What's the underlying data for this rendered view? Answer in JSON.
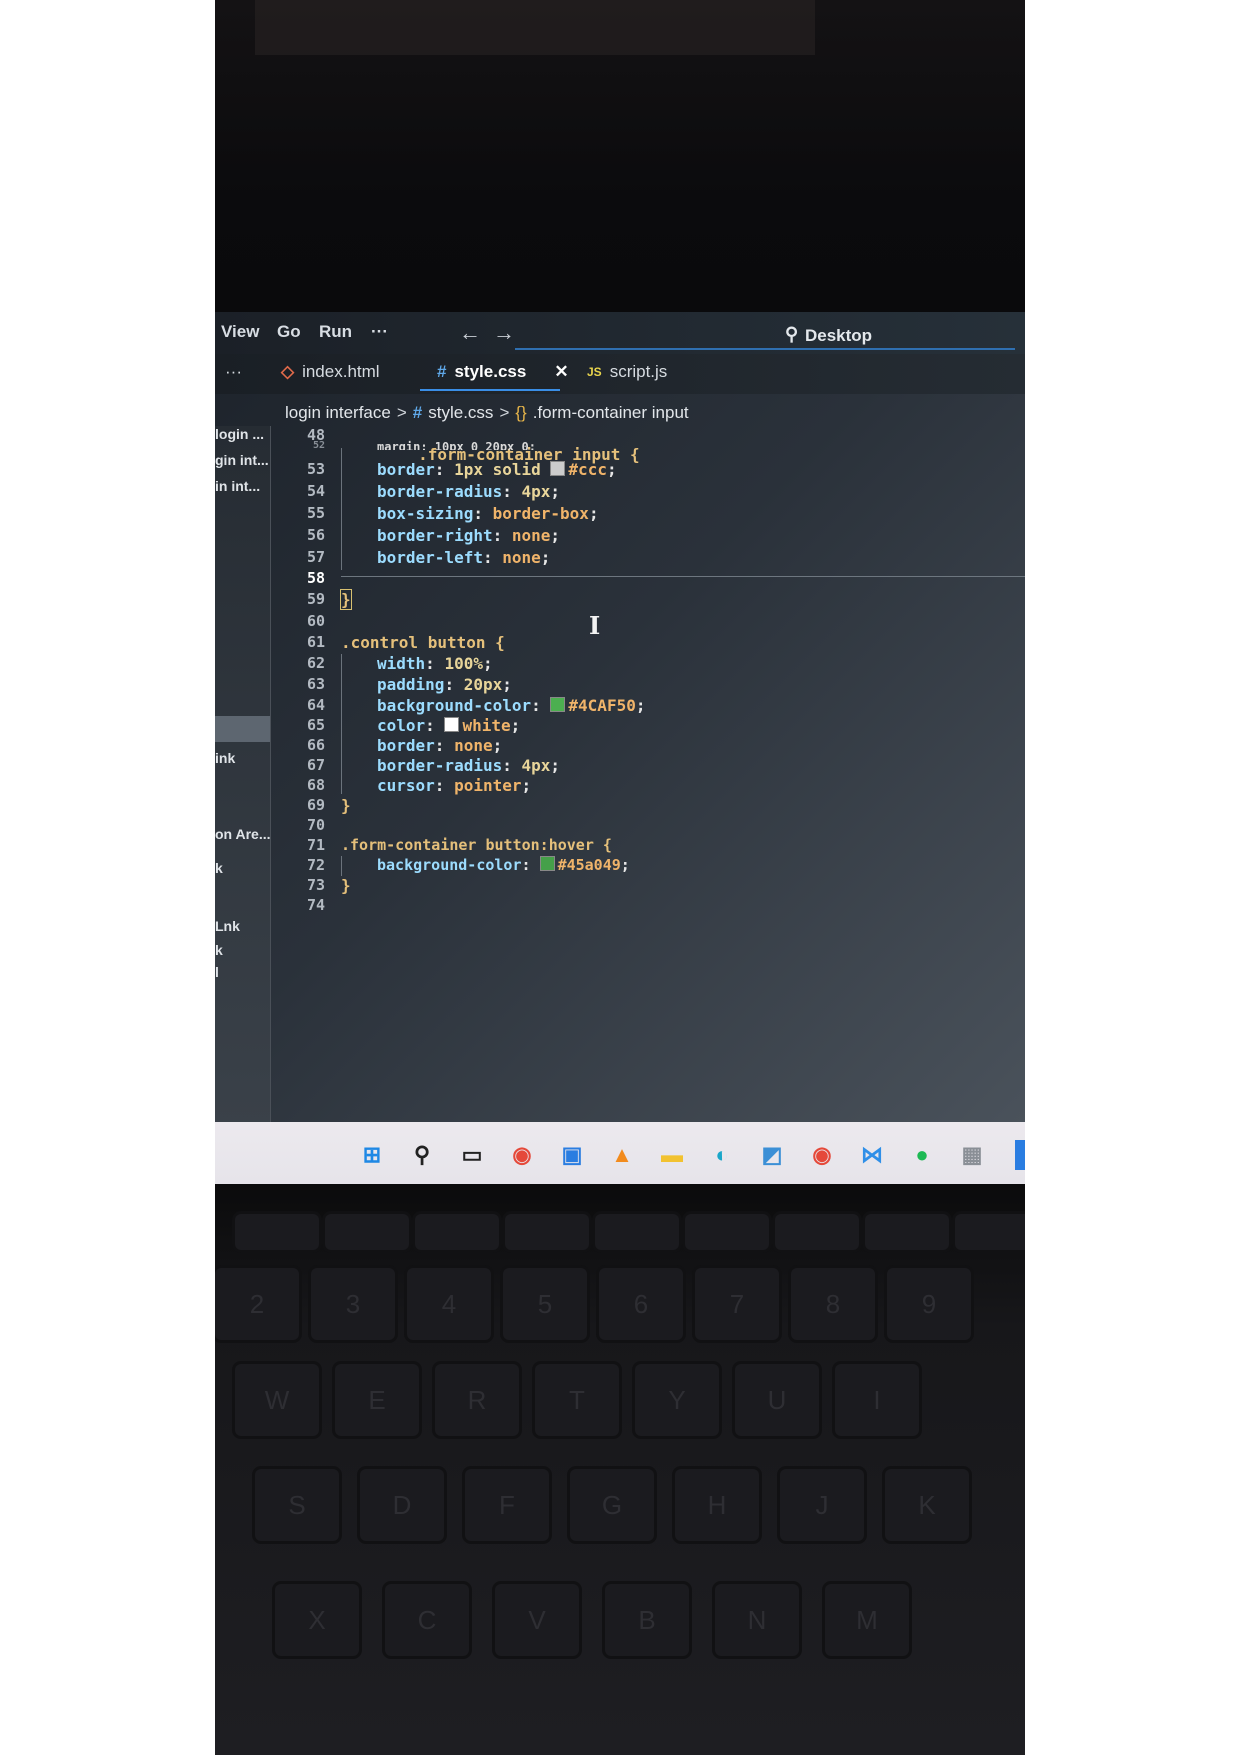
{
  "menubar": {
    "items": [
      "View",
      "Go",
      "Run",
      "···"
    ],
    "back_arrow": "←",
    "forward_arrow": "→",
    "search_label": "Desktop",
    "search_icon": "search-icon"
  },
  "tabs": {
    "overflow": "···",
    "items": [
      {
        "icon": "◇",
        "label": "index.html"
      },
      {
        "icon": "#",
        "label": "style.css",
        "close": "✕"
      },
      {
        "icon": "JS",
        "label": "script.js"
      }
    ]
  },
  "breadcrumb": {
    "folder": "login interface",
    "sep": ">",
    "file_icon": "#",
    "file": "style.css",
    "symbol_icon": "{}",
    "symbol": ".form-container input"
  },
  "sidebar": {
    "items": [
      "login ...",
      "gin int...",
      "in int...",
      "ink",
      "on Are...",
      "k",
      "Lnk",
      "k",
      "l"
    ]
  },
  "editor": {
    "line_numbers": [
      "48",
      "52",
      "53",
      "54",
      "55",
      "56",
      "57",
      "58",
      "59",
      "60",
      "61",
      "62",
      "63",
      "64",
      "65",
      "66",
      "67",
      "68",
      "69",
      "70",
      "71",
      "72",
      "73",
      "74"
    ],
    "sticky": {
      "selector": ".form-container input",
      "brace": "{"
    },
    "partial_line": "margin: 10px 0 20px 0;",
    "lines": {
      "l53": {
        "prop": "border",
        "val": "1px solid",
        "color_val": "#ccc",
        "swatch": "#cccccc"
      },
      "l54": {
        "prop": "border-radius",
        "val": "4px"
      },
      "l55": {
        "prop": "box-sizing",
        "val": "border-box"
      },
      "l56": {
        "prop": "border-right",
        "val": "none"
      },
      "l57": {
        "prop": "border-left",
        "val": "none"
      },
      "l59": {
        "brace": "}"
      },
      "l61": {
        "selector": ".control button",
        "brace": "{"
      },
      "l62": {
        "prop": "width",
        "val": "100%"
      },
      "l63": {
        "prop": "padding",
        "val": "20px"
      },
      "l64": {
        "prop": "background-color",
        "color_val": "#4CAF50",
        "swatch": "#4CAF50"
      },
      "l65": {
        "prop": "color",
        "color_val": "white",
        "swatch": "#ffffff"
      },
      "l66": {
        "prop": "border",
        "val": "none"
      },
      "l67": {
        "prop": "border-radius",
        "val": "4px"
      },
      "l68": {
        "prop": "cursor",
        "val": "pointer"
      },
      "l69": {
        "brace": "}"
      },
      "l71": {
        "selector": ".form-container button:hover",
        "brace": "{"
      },
      "l72": {
        "prop": "background-color",
        "color_val": "#45a049",
        "swatch": "#45a049"
      },
      "l73": {
        "brace": "}"
      }
    },
    "colon": ":",
    "semicolon": ";",
    "current_line": "58",
    "text_cursor": "I"
  },
  "taskbar": {
    "icons": [
      "windows-start-icon",
      "search-icon",
      "task-view-icon",
      "chrome-icon",
      "store-icon",
      "vlc-icon",
      "file-explorer-icon",
      "edge-icon",
      "photos-icon",
      "chrome-profile-icon",
      "vscode-icon",
      "spotify-icon",
      "calculator-icon"
    ]
  },
  "keyboard": {
    "row_numbers": [
      "2",
      "3",
      "4",
      "5",
      "6",
      "7",
      "8",
      "9"
    ],
    "row_symbols": [
      "@",
      "#",
      "$",
      "%",
      "^",
      "&",
      "*",
      "("
    ],
    "row_letters_1": [
      "W",
      "E",
      "R",
      "T",
      "Y",
      "U",
      "I"
    ],
    "row_letters_2": [
      "S",
      "D",
      "F",
      "G",
      "H",
      "J",
      "K"
    ],
    "row_letters_3": [
      "X",
      "C",
      "V",
      "B",
      "N",
      "M"
    ]
  }
}
